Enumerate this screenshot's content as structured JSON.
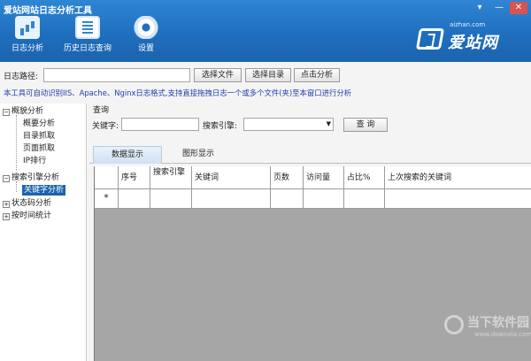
{
  "app": {
    "title": "爱站网站日志分析工具"
  },
  "window_controls": {
    "menu": "▾",
    "minimize": "—",
    "close": "✕"
  },
  "toolbar": [
    {
      "label": "日志分析",
      "icon": "log-analysis-icon"
    },
    {
      "label": "历史日志查询",
      "icon": "history-log-icon"
    },
    {
      "label": "设置",
      "icon": "settings-gear-icon"
    }
  ],
  "brand": {
    "url": "aizhan.com",
    "name": "爱站网"
  },
  "path": {
    "label": "日志路径:",
    "value": ""
  },
  "buttons": {
    "choose_file": "选择文件",
    "choose_dir": "选择目录",
    "analyze": "点击分析"
  },
  "info": "本工具可自动识别IIS、Apache、Nginx日志格式,支持直接拖拽日志一个或多个文件(夹)至本窗口进行分析",
  "tree": {
    "overview": "概貌分析",
    "overview_children": [
      "概要分析",
      "目录抓取",
      "页面抓取",
      "IP排行"
    ],
    "search_engine": "搜索引擎分析",
    "keyword": "关键字分析",
    "status": "状态码分析",
    "time": "按时间统计"
  },
  "query": {
    "title": "查询",
    "keyword_label": "关键字:",
    "keyword_value": "",
    "engine_label": "搜索引擎:",
    "engine_value": "",
    "button": "查 询"
  },
  "tabs": {
    "data": "数据显示",
    "graph": "图形显示"
  },
  "grid": {
    "columns": [
      "序号",
      "搜索引擎",
      "关键词",
      "页数",
      "访问量",
      "占比%",
      "上次搜索的关键词"
    ],
    "new_row_marker": "*"
  },
  "watermark": {
    "text": "当下软件园",
    "url": "www.downxia.com"
  },
  "colors": {
    "header": "#1f6fbf",
    "selected": "#1b63ad",
    "info_text": "#1f3ea8",
    "grid_bg": "#a6a6a6"
  }
}
